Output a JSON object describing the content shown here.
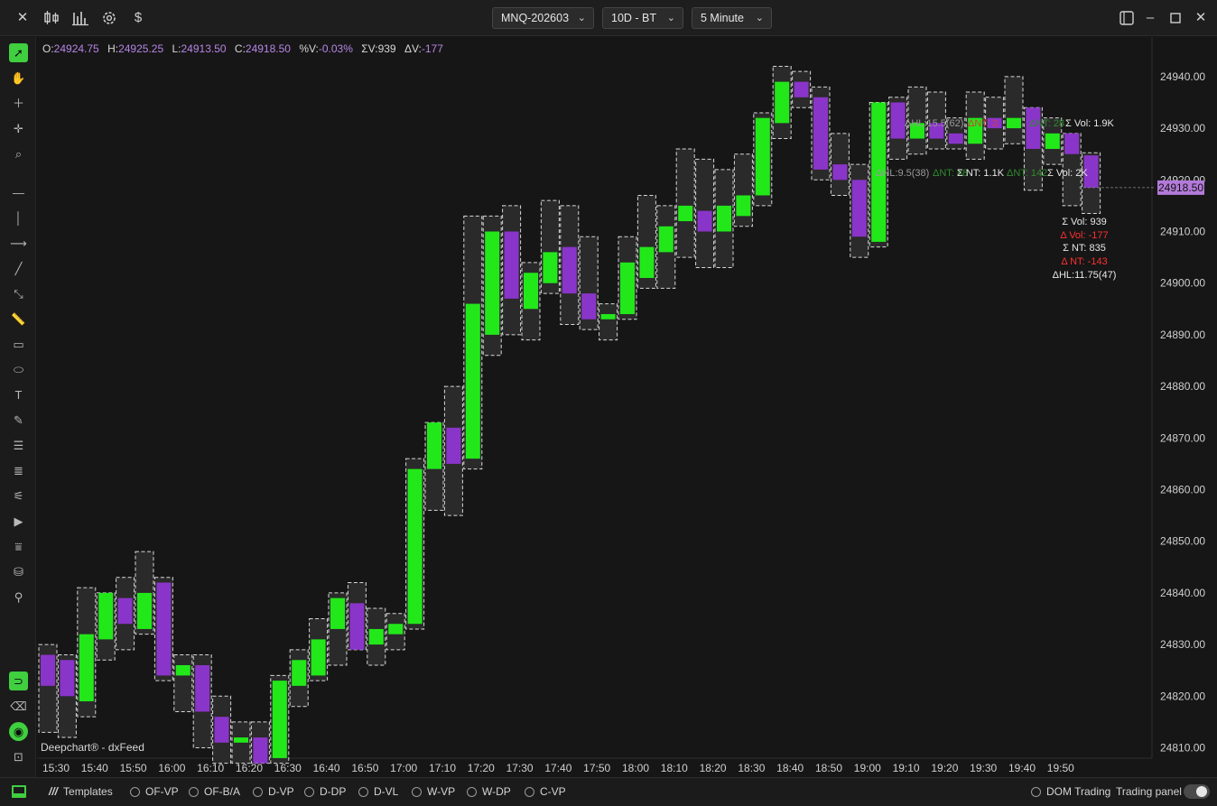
{
  "titlebar": {
    "symbol": "MNQ-202603",
    "range": "10D - BT",
    "interval": "5 Minute"
  },
  "ohlc": {
    "o_label": "O:",
    "o_value": "24924.75",
    "h_label": "H:",
    "h_value": "24925.25",
    "l_label": "L:",
    "l_value": "24913.50",
    "c_label": "C:",
    "c_value": "24918.50",
    "pv_label": "%V:",
    "pv_value": "-0.03%",
    "sv_label": "ΣV:",
    "sv_value": "939",
    "dv_label": "ΔV:",
    "dv_value": "-177"
  },
  "watermark": "Deepchart® - dxFeed",
  "colors": {
    "bull": "#22e81a",
    "bear": "#8a35c9",
    "background": "#161616",
    "accent": "#3fcf3f",
    "last_price_bg": "#b37ad9"
  },
  "bottombar": {
    "templates": "Templates",
    "options": [
      "OF-VP",
      "OF-B/A",
      "D-VP",
      "D-DP",
      "D-VL",
      "W-VP",
      "W-DP",
      "C-VP"
    ],
    "dom_trading": "DOM Trading",
    "trading_panel": "Trading panel"
  },
  "chart_data": {
    "type": "candlestick",
    "x_axis_labels": [
      "15:30",
      "15:40",
      "15:50",
      "16:00",
      "16:10",
      "16:20",
      "16:30",
      "16:40",
      "16:50",
      "17:00",
      "17:10",
      "17:20",
      "17:30",
      "17:40",
      "17:50",
      "18:00",
      "18:10",
      "18:20",
      "18:30",
      "18:40",
      "18:50",
      "19:00",
      "19:10",
      "19:20",
      "19:30",
      "19:40",
      "19:50"
    ],
    "y_ticks": [
      24810,
      24820,
      24830,
      24840,
      24850,
      24860,
      24870,
      24880,
      24890,
      24900,
      24910,
      24920,
      24930,
      24940
    ],
    "ylim": [
      24807,
      24950
    ],
    "last_price": 24918.5,
    "last_price_label": "24918.50",
    "candles": [
      {
        "t": "15:15",
        "o": 24828.0,
        "h": 24830.0,
        "l": 24813.0,
        "c": 24822.0
      },
      {
        "t": "15:20",
        "o": 24827.0,
        "h": 24828.0,
        "l": 24812.0,
        "c": 24820.0
      },
      {
        "t": "15:25",
        "o": 24819.0,
        "h": 24841.0,
        "l": 24816.0,
        "c": 24832.0
      },
      {
        "t": "15:30",
        "o": 24831.0,
        "h": 24840.0,
        "l": 24827.0,
        "c": 24840.0
      },
      {
        "t": "15:35",
        "o": 24839.0,
        "h": 24843.0,
        "l": 24829.0,
        "c": 24834.0
      },
      {
        "t": "15:40",
        "o": 24833.0,
        "h": 24848.0,
        "l": 24832.0,
        "c": 24840.0
      },
      {
        "t": "15:45",
        "o": 24842.0,
        "h": 24843.0,
        "l": 24823.0,
        "c": 24824.0
      },
      {
        "t": "15:50",
        "o": 24824.0,
        "h": 24828.0,
        "l": 24817.0,
        "c": 24826.0
      },
      {
        "t": "15:55",
        "o": 24826.0,
        "h": 24828.0,
        "l": 24810.0,
        "c": 24817.0
      },
      {
        "t": "16:00",
        "o": 24816.0,
        "h": 24820.0,
        "l": 24807.0,
        "c": 24811.0
      },
      {
        "t": "16:05",
        "o": 24811.0,
        "h": 24815.0,
        "l": 24807.0,
        "c": 24812.0
      },
      {
        "t": "16:10",
        "o": 24812.0,
        "h": 24815.0,
        "l": 24807.0,
        "c": 24807.0
      },
      {
        "t": "16:15",
        "o": 24808.0,
        "h": 24824.0,
        "l": 24807.0,
        "c": 24823.0
      },
      {
        "t": "16:20",
        "o": 24822.0,
        "h": 24829.0,
        "l": 24818.0,
        "c": 24827.0
      },
      {
        "t": "16:25",
        "o": 24824.0,
        "h": 24835.0,
        "l": 24823.0,
        "c": 24831.0
      },
      {
        "t": "16:30",
        "o": 24833.0,
        "h": 24840.0,
        "l": 24826.0,
        "c": 24839.0
      },
      {
        "t": "16:35",
        "o": 24838.0,
        "h": 24842.0,
        "l": 24829.0,
        "c": 24829.0
      },
      {
        "t": "16:40",
        "o": 24830.0,
        "h": 24837.0,
        "l": 24826.0,
        "c": 24833.0
      },
      {
        "t": "16:45",
        "o": 24832.0,
        "h": 24836.0,
        "l": 24829.0,
        "c": 24834.0
      },
      {
        "t": "16:50",
        "o": 24834.0,
        "h": 24866.0,
        "l": 24833.0,
        "c": 24864.0
      },
      {
        "t": "16:55",
        "o": 24864.0,
        "h": 24873.0,
        "l": 24856.0,
        "c": 24873.0
      },
      {
        "t": "17:00",
        "o": 24872.0,
        "h": 24880.0,
        "l": 24855.0,
        "c": 24865.0
      },
      {
        "t": "17:05",
        "o": 24866.0,
        "h": 24913.0,
        "l": 24864.0,
        "c": 24896.0
      },
      {
        "t": "17:10",
        "o": 24890.0,
        "h": 24913.0,
        "l": 24886.0,
        "c": 24910.0
      },
      {
        "t": "17:15",
        "o": 24910.0,
        "h": 24915.0,
        "l": 24890.0,
        "c": 24897.0
      },
      {
        "t": "17:20",
        "o": 24895.0,
        "h": 24904.0,
        "l": 24889.0,
        "c": 24902.0
      },
      {
        "t": "17:25",
        "o": 24900.0,
        "h": 24916.0,
        "l": 24898.0,
        "c": 24906.0
      },
      {
        "t": "17:30",
        "o": 24907.0,
        "h": 24915.0,
        "l": 24892.0,
        "c": 24898.0
      },
      {
        "t": "17:35",
        "o": 24898.0,
        "h": 24909.0,
        "l": 24891.0,
        "c": 24893.0
      },
      {
        "t": "17:40",
        "o": 24893.0,
        "h": 24896.0,
        "l": 24889.0,
        "c": 24894.0
      },
      {
        "t": "17:45",
        "o": 24894.0,
        "h": 24909.0,
        "l": 24893.0,
        "c": 24904.0
      },
      {
        "t": "17:50",
        "o": 24901.0,
        "h": 24917.0,
        "l": 24899.0,
        "c": 24907.0
      },
      {
        "t": "17:55",
        "o": 24906.0,
        "h": 24915.0,
        "l": 24899.0,
        "c": 24911.0
      },
      {
        "t": "18:00",
        "o": 24912.0,
        "h": 24926.0,
        "l": 24905.0,
        "c": 24915.0
      },
      {
        "t": "18:05",
        "o": 24914.0,
        "h": 24924.0,
        "l": 24903.0,
        "c": 24910.0
      },
      {
        "t": "18:10",
        "o": 24910.0,
        "h": 24922.0,
        "l": 24903.0,
        "c": 24915.0
      },
      {
        "t": "18:15",
        "o": 24913.0,
        "h": 24925.0,
        "l": 24911.0,
        "c": 24917.0
      },
      {
        "t": "18:20",
        "o": 24917.0,
        "h": 24933.0,
        "l": 24915.0,
        "c": 24932.0
      },
      {
        "t": "18:25",
        "o": 24931.0,
        "h": 24942.0,
        "l": 24928.0,
        "c": 24939.0
      },
      {
        "t": "18:30",
        "o": 24939.0,
        "h": 24941.0,
        "l": 24934.0,
        "c": 24936.0
      },
      {
        "t": "18:35",
        "o": 24936.0,
        "h": 24938.0,
        "l": 24920.0,
        "c": 24922.0
      },
      {
        "t": "18:40",
        "o": 24923.0,
        "h": 24929.0,
        "l": 24917.0,
        "c": 24920.0
      },
      {
        "t": "18:45",
        "o": 24920.0,
        "h": 24923.0,
        "l": 24905.0,
        "c": 24909.0
      },
      {
        "t": "18:50",
        "o": 24908.0,
        "h": 24935.0,
        "l": 24907.0,
        "c": 24935.0
      },
      {
        "t": "18:55",
        "o": 24935.0,
        "h": 24936.0,
        "l": 24924.0,
        "c": 24928.0
      },
      {
        "t": "19:00",
        "o": 24928.0,
        "h": 24938.0,
        "l": 24925.0,
        "c": 24931.0
      },
      {
        "t": "19:05",
        "o": 24931.0,
        "h": 24937.0,
        "l": 24926.0,
        "c": 24928.0
      },
      {
        "t": "19:10",
        "o": 24929.0,
        "h": 24932.0,
        "l": 24926.0,
        "c": 24927.0
      },
      {
        "t": "19:15",
        "o": 24927.0,
        "h": 24937.0,
        "l": 24924.0,
        "c": 24932.0
      },
      {
        "t": "19:20",
        "o": 24932.0,
        "h": 24936.0,
        "l": 24926.0,
        "c": 24930.0
      },
      {
        "t": "19:25",
        "o": 24930.0,
        "h": 24940.0,
        "l": 24927.0,
        "c": 24932.0
      },
      {
        "t": "19:30",
        "o": 24934.0,
        "h": 24934.0,
        "l": 24918.0,
        "c": 24926.0
      },
      {
        "t": "19:35",
        "o": 24926.0,
        "h": 24932.0,
        "l": 24923.0,
        "c": 24929.0
      },
      {
        "t": "19:40",
        "o": 24929.0,
        "h": 24929.0,
        "l": 24915.0,
        "c": 24925.0
      },
      {
        "t": "19:45",
        "o": 24924.75,
        "h": 24925.25,
        "l": 24913.5,
        "c": 24918.5
      }
    ],
    "annotations": {
      "row1": [
        {
          "text": "ΔHL:15.5(62)",
          "color": "#9a9a9a"
        },
        {
          "text": "ΔNT: 3",
          "color": "#d83a3a"
        },
        {
          "text": "ΔNT: 28",
          "color": "#2e8b2e"
        },
        {
          "text": "Σ Vol: 1.9K",
          "color": "#e8e8e8"
        }
      ],
      "row2": [
        {
          "text": "ΔHL:9.5(38)",
          "color": "#9a9a9a"
        },
        {
          "text": "ΔNT: 88",
          "color": "#2e8b2e"
        },
        {
          "text": "Σ NT: 1.1K",
          "color": "#e8e8e8"
        },
        {
          "text": "ΔNT: 142",
          "color": "#2e8b2e"
        },
        {
          "text": "Σ Vol: 2K",
          "color": "#e8e8e8"
        }
      ],
      "last_stats": [
        {
          "text": "Σ Vol: 939",
          "color": "#e8e8e8"
        },
        {
          "text": "Δ Vol: -177",
          "color": "#ff3030"
        },
        {
          "text": "Σ NT: 835",
          "color": "#e8e8e8"
        },
        {
          "text": "Δ NT: -143",
          "color": "#ff3030"
        },
        {
          "text": "ΔHL:11.75(47)",
          "color": "#e8e8e8"
        }
      ]
    }
  }
}
